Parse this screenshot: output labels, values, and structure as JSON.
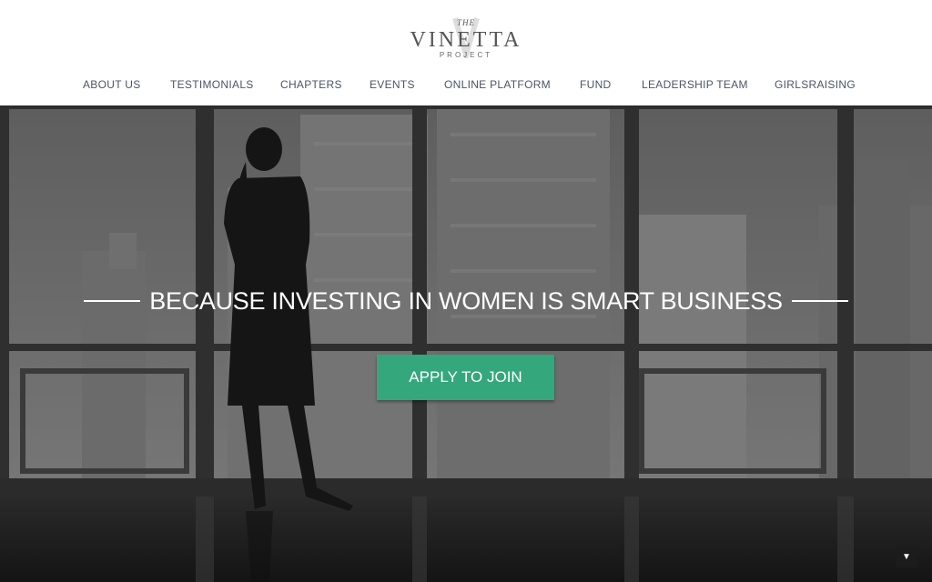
{
  "logo": {
    "the": "THE",
    "name": "VINETTA",
    "sub": "PROJECT"
  },
  "nav": [
    {
      "label": "ABOUT US"
    },
    {
      "label": "TESTIMONIALS"
    },
    {
      "label": "CHAPTERS"
    },
    {
      "label": "EVENTS"
    },
    {
      "label": "ONLINE PLATFORM"
    },
    {
      "label": "FUND"
    },
    {
      "label": "LEADERSHIP TEAM"
    },
    {
      "label": "GIRLSRAISING"
    }
  ],
  "hero": {
    "tagline": "BECAUSE INVESTING IN WOMEN IS SMART BUSINESS",
    "cta_label": "APPLY TO JOIN",
    "scroll_icon": "▼"
  },
  "colors": {
    "accent": "#34a77d",
    "nav_text": "#4a5566"
  }
}
